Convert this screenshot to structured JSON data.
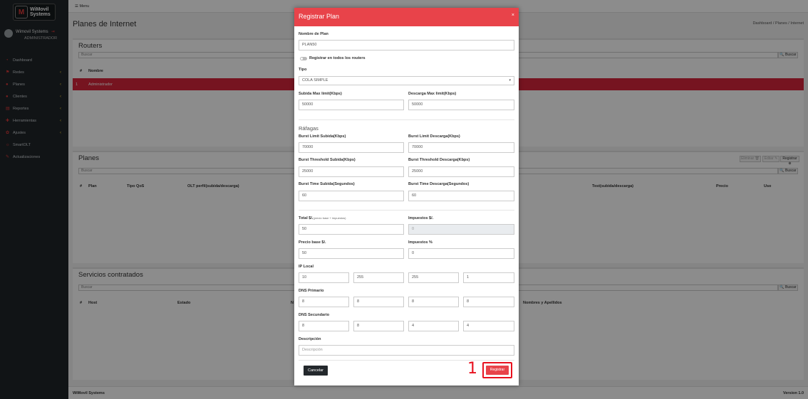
{
  "app": {
    "brand_line1": "WiMovil",
    "brand_line2": "Systems",
    "brand_mark": "M"
  },
  "topbar": {
    "menu_label": "☰ Menu"
  },
  "user": {
    "name": "Wimovil Systems",
    "role": "ADMINISTRADOR"
  },
  "sidebar": {
    "items": [
      {
        "label": "Dashboard",
        "icon": "dashboard-icon",
        "glyph": "◔"
      },
      {
        "label": "Redes",
        "icon": "network-icon",
        "glyph": "⚑"
      },
      {
        "label": "Planes",
        "icon": "plans-icon",
        "glyph": "●"
      },
      {
        "label": "Clientes",
        "icon": "clients-icon",
        "glyph": "●"
      },
      {
        "label": "Reportes",
        "icon": "reports-icon",
        "glyph": "▤"
      },
      {
        "label": "Herramientas",
        "icon": "tools-icon",
        "glyph": "✚"
      },
      {
        "label": "Ajustes",
        "icon": "settings-icon",
        "glyph": "✿"
      },
      {
        "label": "SmartOLT",
        "icon": "smartolt-icon",
        "glyph": "☼"
      },
      {
        "label": "Actualizaciones",
        "icon": "updates-icon",
        "glyph": "✎"
      }
    ]
  },
  "page": {
    "title": "Planes de Internet",
    "breadcrumb": "Dashboard  /  Planes / Internet"
  },
  "routers": {
    "title": "Routers",
    "search_placeholder": "Buscar",
    "search_button": "🔍 Buscar",
    "columns": [
      "#",
      "Nombre"
    ],
    "rows": [
      {
        "n": "1",
        "name": "Administrador"
      }
    ]
  },
  "planes": {
    "title": "Planes",
    "search_placeholder": "Buscar",
    "search_button": "🔍 Buscar",
    "actions": {
      "delete": "Eliminar 🗑",
      "edit": "Editar ✎",
      "register": "Registrar ⊕"
    },
    "columns": [
      "#",
      "Plan",
      "Tipo QoS",
      "OLT perfil(subida/descarga)",
      "Test(subida/descarga)",
      "Precio",
      "Uso"
    ]
  },
  "servicios": {
    "title": "Servicios contratados",
    "search_placeholder": "Buscar",
    "search_button": "🔍 Buscar",
    "columns": [
      "#",
      "Host",
      "Estado",
      "N",
      "Nombres y Apellidos"
    ]
  },
  "footer": {
    "left": "WiMovil Systems",
    "right": "Version 1.0"
  },
  "modal": {
    "title": "Registrar Plan",
    "close": "×",
    "nombre_label": "Nombre de Plan",
    "nombre_value": "PLAN50",
    "toggle_label": "Registrar en todos los routers",
    "tipo_label": "Tipo",
    "tipo_value": "COLA SIMPLE",
    "subida_label": "Subida Max limit(Kbps)",
    "subida_value": "50000",
    "descarga_label": "Descarga Max limit(Kbps)",
    "descarga_value": "50000",
    "rafagas_title": "Ráfagas",
    "burst_limit_subida_label": "Burst Limit Subida(Kbps)",
    "burst_limit_subida_value": "70000",
    "burst_limit_descarga_label": "Burst Limit Descarga(Kbps)",
    "burst_limit_descarga_value": "70000",
    "burst_threshold_subida_label": "Burst Threshold Subida(Kbps)",
    "burst_threshold_subida_value": "25000",
    "burst_threshold_descarga_label": "Burst Threshold Descarga(Kbps)",
    "burst_threshold_descarga_value": "25000",
    "burst_time_subida_label": "Burst Time Subida(Segundos)",
    "burst_time_subida_value": "60",
    "burst_time_descarga_label": "Burst Time Descarga(Segundos)",
    "burst_time_descarga_value": "60",
    "total_label": "Total $/.",
    "total_hint": "(precio base + impuestos)",
    "total_value": "50",
    "impuestos_label": "Impuestos $/.",
    "impuestos_value": "0",
    "precio_label": "Precio base $/.",
    "precio_value": "50",
    "impuestos_pct_label": "Impuestos %",
    "impuestos_pct_value": "0",
    "ip_label": "IP Local",
    "ip": [
      "10",
      "255",
      "255",
      "1"
    ],
    "dns1_label": "DNS Primario",
    "dns1": [
      "8",
      "8",
      "8",
      "8"
    ],
    "dns2_label": "DNS Secundario",
    "dns2": [
      "8",
      "8",
      "4",
      "4"
    ],
    "descripcion_label": "Descripción",
    "descripcion_placeholder": "Descripción",
    "cancel_label": "Cancelar",
    "register_label": "Registrar"
  },
  "annotation": {
    "step": "1"
  }
}
